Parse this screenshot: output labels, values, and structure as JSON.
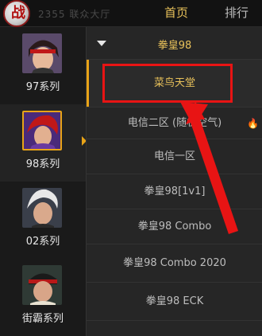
{
  "header": {
    "logo_glyph": "战",
    "app_title": "2355 联众大厅",
    "tabs": [
      {
        "label": "首页",
        "active": true
      },
      {
        "label": "排行",
        "active": false
      }
    ],
    "accent": "#e8c15a"
  },
  "series": [
    {
      "label": "97系列",
      "active": false
    },
    {
      "label": "98系列",
      "active": true
    },
    {
      "label": "02系列",
      "active": false
    },
    {
      "label": "街霸系列",
      "active": false
    }
  ],
  "server_list": {
    "group_title": "拳皇98",
    "servers": [
      {
        "label": "菜鸟天堂",
        "selected": true,
        "hot": false
      },
      {
        "label": "电信二区 (随机空气)",
        "selected": false,
        "hot": true
      },
      {
        "label": "电信一区",
        "selected": false,
        "hot": false
      },
      {
        "label": "拳皇98[1v1]",
        "selected": false,
        "hot": false
      },
      {
        "label": "拳皇98 Combo",
        "selected": false,
        "hot": false
      },
      {
        "label": "拳皇98 Combo 2020",
        "selected": false,
        "hot": false
      },
      {
        "label": "拳皇98 ECK",
        "selected": false,
        "hot": false
      }
    ]
  },
  "annotation": {
    "highlight_color": "#e81414",
    "arrow_color": "#e81414"
  },
  "icons": {
    "caret": "caret-down-icon",
    "hot": "fire-icon"
  }
}
